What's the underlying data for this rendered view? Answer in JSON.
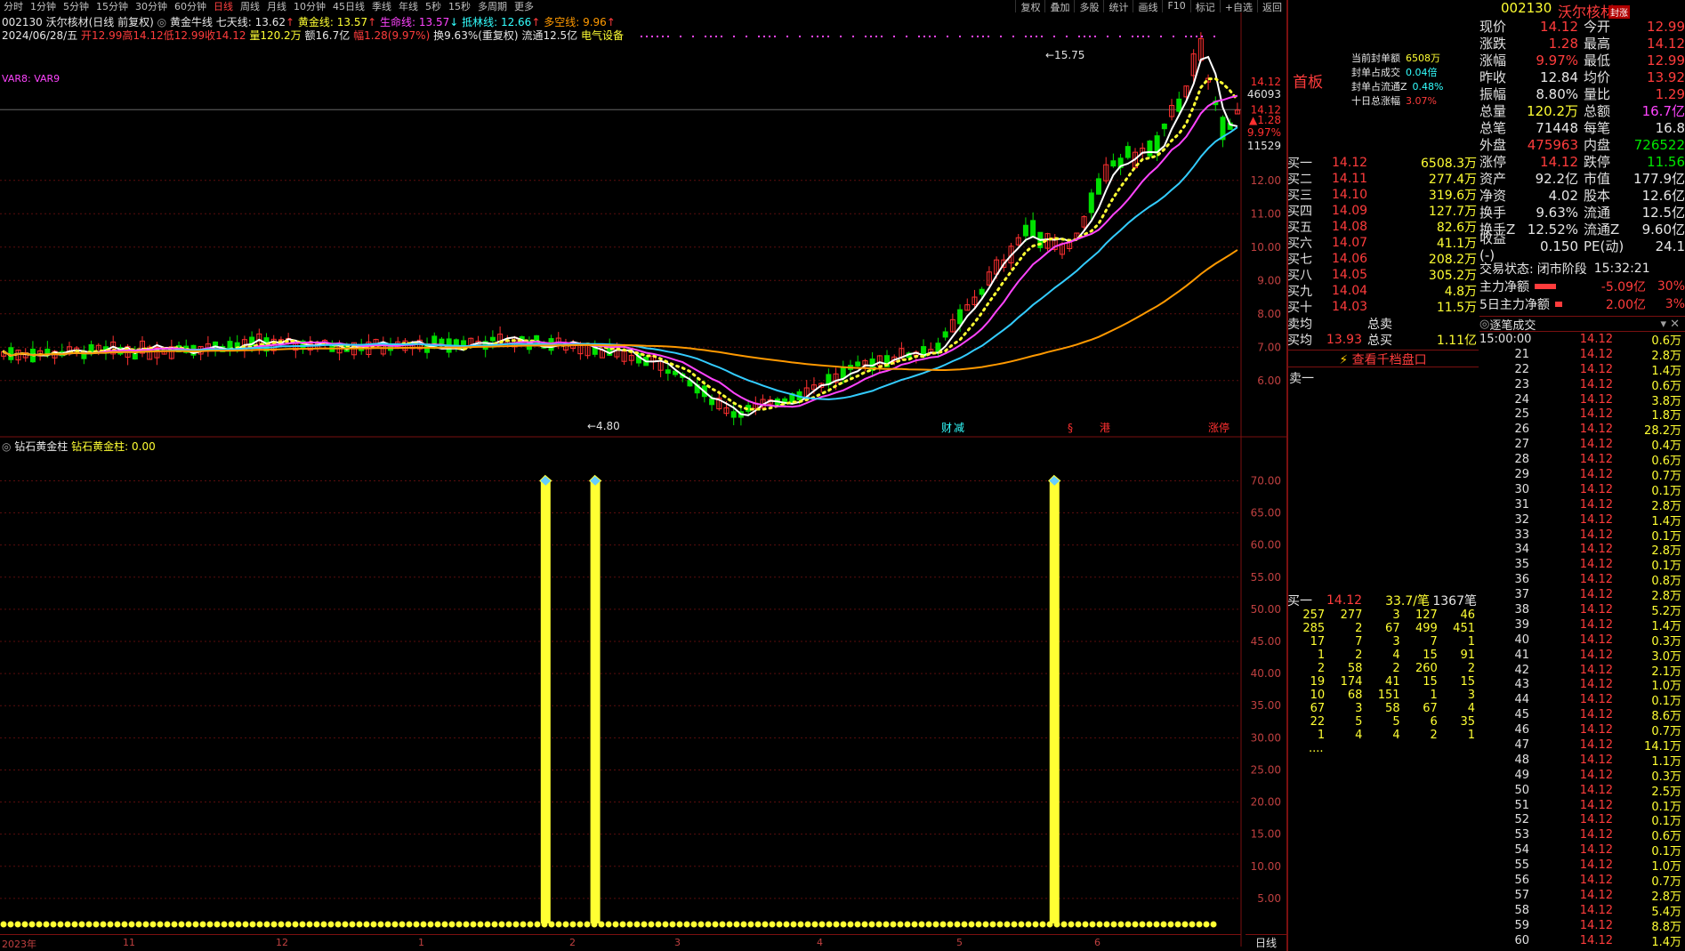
{
  "toolbar": {
    "periods": [
      "分时",
      "1分钟",
      "5分钟",
      "15分钟",
      "30分钟",
      "60分钟",
      "日线",
      "周线",
      "月线",
      "10分钟",
      "45日线",
      "季线",
      "年线",
      "5秒",
      "15秒",
      "多周期",
      "更多"
    ],
    "active_period": "日线",
    "right_items": [
      "复权",
      "叠加",
      "多股",
      "统计",
      "画线",
      "F10",
      "标记",
      "+自选",
      "返回"
    ]
  },
  "info": {
    "line1": {
      "title": "002130 沃尔核材(日线 前复权)",
      "indicator_name": "黄金牛线",
      "ma7_label": "七天线: 13.62",
      "gold_label": "黄金线: 13.57",
      "life_label": "生命线: 13.57",
      "rise_label": "抵林线: 12.66",
      "bull_label": "多空线: 9.96"
    },
    "line2": {
      "date": "2024/06/28/五",
      "open": "开12.99",
      "high": "高14.12",
      "low": "低12.99",
      "close": "收14.12",
      "vol": "量120.2万",
      "amount": "额16.7亿",
      "change": "幅1.28(9.97%)",
      "turnover": "换9.63%(重复权)",
      "float": "流通12.5亿",
      "sector": "电气设备"
    },
    "var_label": "VAR8: VAR9"
  },
  "lower_panel": {
    "title": "钻石黄金柱",
    "value_label": "钻石黄金柱: 0.00"
  },
  "axes": {
    "price_ticks": [
      "14.12",
      "12.00",
      "11.00",
      "10.00",
      "9.00",
      "8.00",
      "7.00",
      "6.00"
    ],
    "right_readout": [
      "46093",
      "14.12",
      "1.28",
      "9.97%",
      "11529"
    ],
    "lower_ticks": [
      "70.00",
      "65.00",
      "60.00",
      "55.00",
      "50.00",
      "45.00",
      "40.00",
      "35.00",
      "30.00",
      "25.00",
      "20.00",
      "15.00",
      "10.00",
      "5.00"
    ],
    "time_labels": [
      "2023年",
      "11",
      "12",
      "1",
      "2",
      "3",
      "4",
      "5",
      "6"
    ],
    "period_label": "日线",
    "high_marker": "15.75",
    "low_marker": "4.80",
    "event_labels": [
      "财",
      "减",
      "§",
      "港",
      "涨停"
    ]
  },
  "chart_data": {
    "type": "candlestick",
    "title": "002130 沃尔核材(日线 前复权)",
    "ylim": [
      4.5,
      16.5
    ],
    "last_close": 14.12,
    "high": 15.75,
    "low": 4.8,
    "ma_lines": [
      {
        "name": "七天线",
        "value": 13.62,
        "color": "#ffffff"
      },
      {
        "name": "黄金线",
        "value": 13.57,
        "color": "#ffff33"
      },
      {
        "name": "生命线",
        "value": 13.57,
        "color": "#ff44ff"
      },
      {
        "name": "抵林线",
        "value": 12.66,
        "color": "#33ccff"
      },
      {
        "name": "多空线",
        "value": 9.96,
        "color": "#ff9900"
      }
    ],
    "lower_series": {
      "name": "钻石黄金柱",
      "ylim": [
        0,
        72
      ],
      "bars_at": [
        0.44,
        0.48,
        0.85
      ],
      "bar_value": 70
    }
  },
  "limit_info": {
    "label": "首板",
    "metrics": [
      {
        "k": "当前封单额",
        "v": "6508万",
        "color": "yellow"
      },
      {
        "k": "封单占成交",
        "v": "0.04倍",
        "color": "cyan"
      },
      {
        "k": "封单占流通Z",
        "v": "0.48%",
        "color": "cyan"
      },
      {
        "k": "十日总涨幅",
        "v": "3.07%",
        "color": "red"
      }
    ]
  },
  "quote_header": {
    "code": "002130",
    "name": "沃尔核材",
    "badge": "封涨"
  },
  "quote": [
    {
      "k": "现价",
      "v": "14.12",
      "c": "red",
      "k2": "今开",
      "v2": "12.99",
      "c2": "red"
    },
    {
      "k": "涨跌",
      "v": "1.28",
      "c": "red",
      "k2": "最高",
      "v2": "14.12",
      "c2": "red"
    },
    {
      "k": "涨幅",
      "v": "9.97%",
      "c": "red",
      "k2": "最低",
      "v2": "12.99",
      "c2": "red"
    },
    {
      "k": "昨收",
      "v": "12.84",
      "c": "white",
      "k2": "均价",
      "v2": "13.92",
      "c2": "red"
    },
    {
      "k": "振幅",
      "v": "8.80%",
      "c": "white",
      "k2": "量比",
      "v2": "1.29",
      "c2": "red"
    },
    {
      "k": "总量",
      "v": "120.2万",
      "c": "yellow",
      "k2": "总额",
      "v2": "16.7亿",
      "c2": "magenta"
    },
    {
      "k": "总笔",
      "v": "71448",
      "c": "white",
      "k2": "每笔",
      "v2": "16.8",
      "c2": "white"
    },
    {
      "k": "外盘",
      "v": "475963",
      "c": "red",
      "k2": "内盘",
      "v2": "726522",
      "c2": "green"
    },
    {
      "k": "涨停",
      "v": "14.12",
      "c": "red",
      "k2": "跌停",
      "v2": "11.56",
      "c2": "green"
    },
    {
      "k": "资产",
      "v": "92.2亿",
      "c": "white",
      "k2": "市值",
      "v2": "177.9亿",
      "c2": "white"
    },
    {
      "k": "净资",
      "v": "4.02",
      "c": "white",
      "k2": "股本",
      "v2": "12.6亿",
      "c2": "white"
    },
    {
      "k": "换手",
      "v": "9.63%",
      "c": "white",
      "k2": "流通",
      "v2": "12.5亿",
      "c2": "white"
    },
    {
      "k": "换手Z",
      "v": "12.52%",
      "c": "white",
      "k2": "流通Z",
      "v2": "9.60亿",
      "c2": "white"
    },
    {
      "k": "收益(-)",
      "v": "0.150",
      "c": "white",
      "k2": "PE(动)",
      "v2": "24.1",
      "c2": "white"
    }
  ],
  "orderbook": [
    {
      "k": "买一",
      "p": "14.12",
      "q": "6508.3万"
    },
    {
      "k": "买二",
      "p": "14.11",
      "q": "277.4万"
    },
    {
      "k": "买三",
      "p": "14.10",
      "q": "319.6万"
    },
    {
      "k": "买四",
      "p": "14.09",
      "q": "127.7万"
    },
    {
      "k": "买五",
      "p": "14.08",
      "q": "82.6万"
    },
    {
      "k": "买六",
      "p": "14.07",
      "q": "41.1万"
    },
    {
      "k": "买七",
      "p": "14.06",
      "q": "208.2万"
    },
    {
      "k": "买八",
      "p": "14.05",
      "q": "305.2万"
    },
    {
      "k": "买九",
      "p": "14.04",
      "q": "4.8万"
    },
    {
      "k": "买十",
      "p": "14.03",
      "q": "11.5万"
    }
  ],
  "avg": {
    "sell_avg_label": "卖均",
    "sell_total_label": "总卖",
    "buy_avg_label": "买均",
    "buy_avg": "13.93",
    "buy_total_label": "总买",
    "buy_total": "1.11亿"
  },
  "view_orderbook": "查看千档盘口",
  "sell_one": "卖一",
  "buy_queue": {
    "label": "买一",
    "price": "14.12",
    "avg": "33.7/笔",
    "count": "1367笔",
    "cells": [
      "257",
      "277",
      "3",
      "127",
      "46",
      "285",
      "2",
      "67",
      "499",
      "451",
      "17",
      "7",
      "3",
      "7",
      "1",
      "1",
      "2",
      "4",
      "15",
      "91",
      "2",
      "58",
      "2",
      "260",
      "2",
      "19",
      "174",
      "41",
      "15",
      "15",
      "10",
      "68",
      "151",
      "1",
      "3",
      "67",
      "3",
      "58",
      "67",
      "4",
      "22",
      "5",
      "5",
      "6",
      "35",
      "1",
      "4",
      "4",
      "2",
      "1"
    ],
    "more": "...."
  },
  "trade_status": {
    "status_label": "交易状态:",
    "status_value": "闭市阶段",
    "time": "15:32:21",
    "main_net_label": "主力净额",
    "main_net_value": "-5.09亿",
    "main_net_pct": "30%",
    "main5_label": "5日主力净额",
    "main5_value": "2.00亿",
    "main5_pct": "3%"
  },
  "ticks": {
    "title": "逐笔成交",
    "rows": [
      {
        "t": "15:00:00",
        "p": "14.12",
        "v": "0.6万"
      },
      {
        "t": "21",
        "p": "14.12",
        "v": "2.8万"
      },
      {
        "t": "22",
        "p": "14.12",
        "v": "1.4万"
      },
      {
        "t": "23",
        "p": "14.12",
        "v": "0.6万"
      },
      {
        "t": "24",
        "p": "14.12",
        "v": "3.8万"
      },
      {
        "t": "25",
        "p": "14.12",
        "v": "1.8万"
      },
      {
        "t": "26",
        "p": "14.12",
        "v": "28.2万"
      },
      {
        "t": "27",
        "p": "14.12",
        "v": "0.4万"
      },
      {
        "t": "28",
        "p": "14.12",
        "v": "0.6万"
      },
      {
        "t": "29",
        "p": "14.12",
        "v": "0.7万"
      },
      {
        "t": "30",
        "p": "14.12",
        "v": "0.1万"
      },
      {
        "t": "31",
        "p": "14.12",
        "v": "2.8万"
      },
      {
        "t": "32",
        "p": "14.12",
        "v": "1.4万"
      },
      {
        "t": "33",
        "p": "14.12",
        "v": "0.1万"
      },
      {
        "t": "34",
        "p": "14.12",
        "v": "2.8万"
      },
      {
        "t": "35",
        "p": "14.12",
        "v": "0.1万"
      },
      {
        "t": "36",
        "p": "14.12",
        "v": "0.8万"
      },
      {
        "t": "37",
        "p": "14.12",
        "v": "2.8万"
      },
      {
        "t": "38",
        "p": "14.12",
        "v": "5.2万"
      },
      {
        "t": "39",
        "p": "14.12",
        "v": "1.4万"
      },
      {
        "t": "40",
        "p": "14.12",
        "v": "0.3万"
      },
      {
        "t": "41",
        "p": "14.12",
        "v": "3.0万"
      },
      {
        "t": "42",
        "p": "14.12",
        "v": "2.1万"
      },
      {
        "t": "43",
        "p": "14.12",
        "v": "1.0万"
      },
      {
        "t": "44",
        "p": "14.12",
        "v": "0.1万"
      },
      {
        "t": "45",
        "p": "14.12",
        "v": "8.6万"
      },
      {
        "t": "46",
        "p": "14.12",
        "v": "0.7万"
      },
      {
        "t": "47",
        "p": "14.12",
        "v": "14.1万"
      },
      {
        "t": "48",
        "p": "14.12",
        "v": "1.1万"
      },
      {
        "t": "49",
        "p": "14.12",
        "v": "0.3万"
      },
      {
        "t": "50",
        "p": "14.12",
        "v": "2.5万"
      },
      {
        "t": "51",
        "p": "14.12",
        "v": "0.1万"
      },
      {
        "t": "52",
        "p": "14.12",
        "v": "0.1万"
      },
      {
        "t": "53",
        "p": "14.12",
        "v": "0.6万"
      },
      {
        "t": "54",
        "p": "14.12",
        "v": "0.1万"
      },
      {
        "t": "55",
        "p": "14.12",
        "v": "1.0万"
      },
      {
        "t": "56",
        "p": "14.12",
        "v": "0.7万"
      },
      {
        "t": "57",
        "p": "14.12",
        "v": "2.8万"
      },
      {
        "t": "58",
        "p": "14.12",
        "v": "5.4万"
      },
      {
        "t": "59",
        "p": "14.12",
        "v": "8.8万"
      },
      {
        "t": "60",
        "p": "14.12",
        "v": "1.4万"
      }
    ]
  }
}
